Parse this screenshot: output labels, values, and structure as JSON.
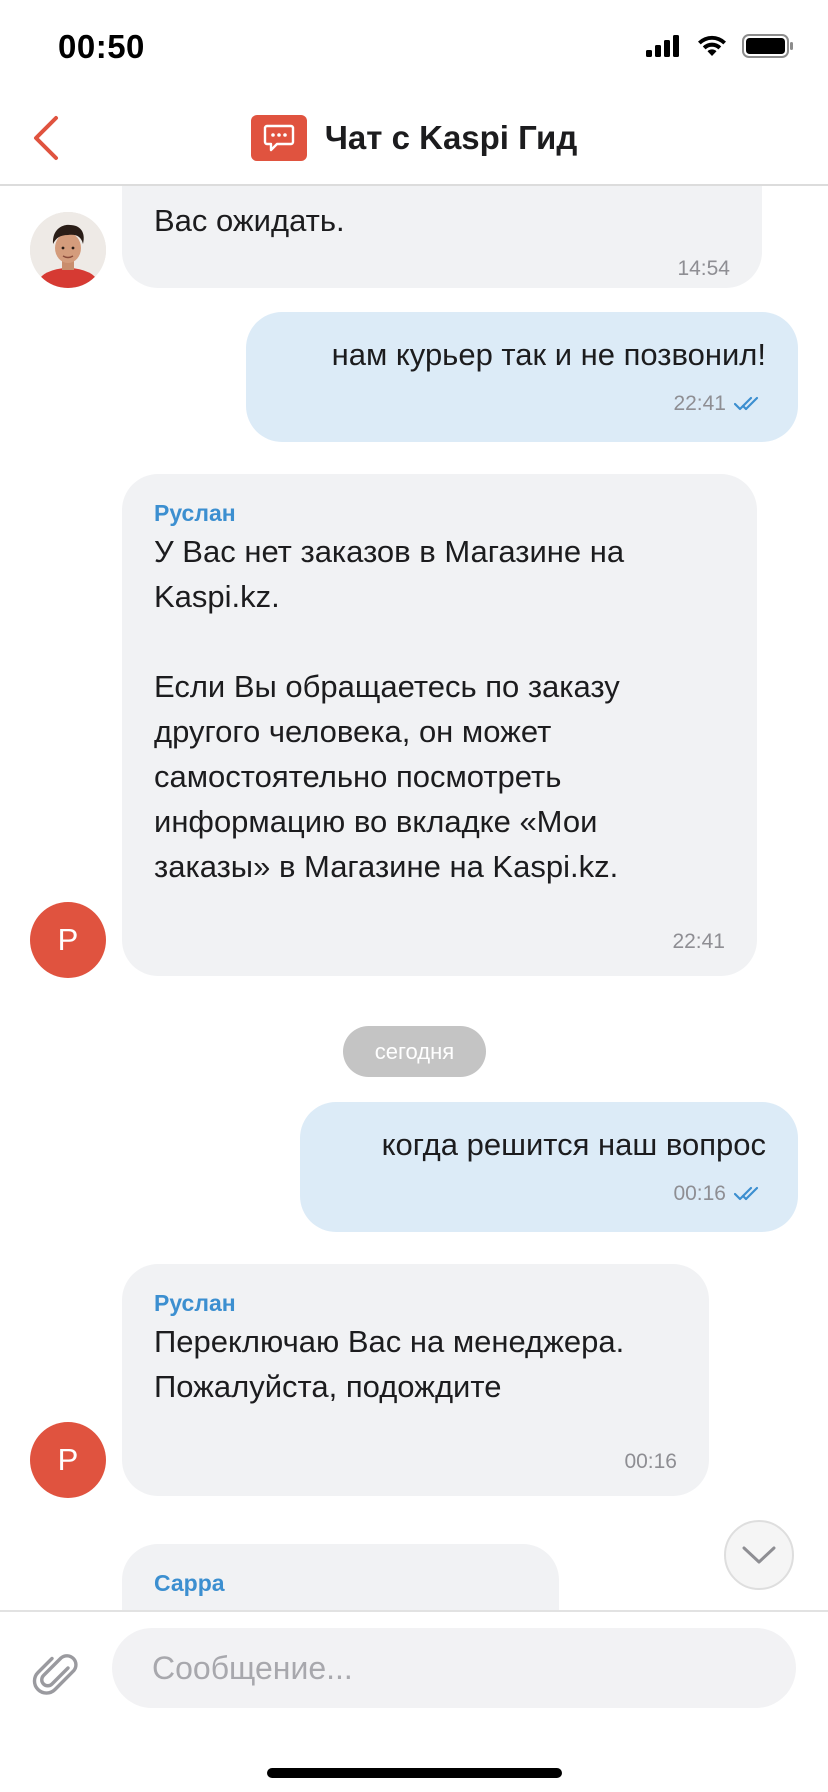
{
  "status_bar": {
    "time": "00:50",
    "icons": [
      "cellular-signal-icon",
      "wifi-icon",
      "battery-icon"
    ]
  },
  "header": {
    "title": "Чат с Kaspi Гид",
    "back_icon": "chevron-left-icon",
    "chat_icon": "chat-bubble-icon",
    "accent_color": "#e0533f"
  },
  "messages": [
    {
      "direction": "incoming",
      "sender": "",
      "text": "Вас ожидать.",
      "time": "14:54",
      "avatar": "photo"
    },
    {
      "direction": "outgoing",
      "text": "нам курьер так и не позвонил!",
      "time": "22:41",
      "status_icon": "double-check-icon"
    },
    {
      "direction": "incoming",
      "sender": "Руслан",
      "text": "У Вас нет заказов в Магазине на Kaspi.kz.\n\nЕсли Вы обращаетесь по заказу другого человека, он может самостоятельно посмотреть информацию во вкладке «Мои заказы» в Магазине на Kaspi.kz.",
      "time": "22:41",
      "avatar_letter": "Р"
    },
    {
      "direction": "outgoing",
      "text": "когда решится наш вопрос",
      "time": "00:16",
      "status_icon": "double-check-icon"
    },
    {
      "direction": "incoming",
      "sender": "Руслан",
      "text": "Переключаю Вас на менеджера. Пожалуйста, подождите",
      "time": "00:16",
      "avatar_letter": "Р"
    },
    {
      "direction": "incoming",
      "sender": "Сарра",
      "text": "",
      "time": ""
    }
  ],
  "date_separator": "сегодня",
  "composer": {
    "placeholder": "Сообщение...",
    "value": "",
    "attach_icon": "paperclip-icon"
  },
  "scroll_down_icon": "chevron-down-icon",
  "colors": {
    "incoming_bubble": "#f1f2f4",
    "outgoing_bubble": "#dcebf7",
    "sender_name": "#3c8fd0",
    "read_ticks": "#3c8fd0",
    "avatar_letter_bg": "#e0533f"
  }
}
